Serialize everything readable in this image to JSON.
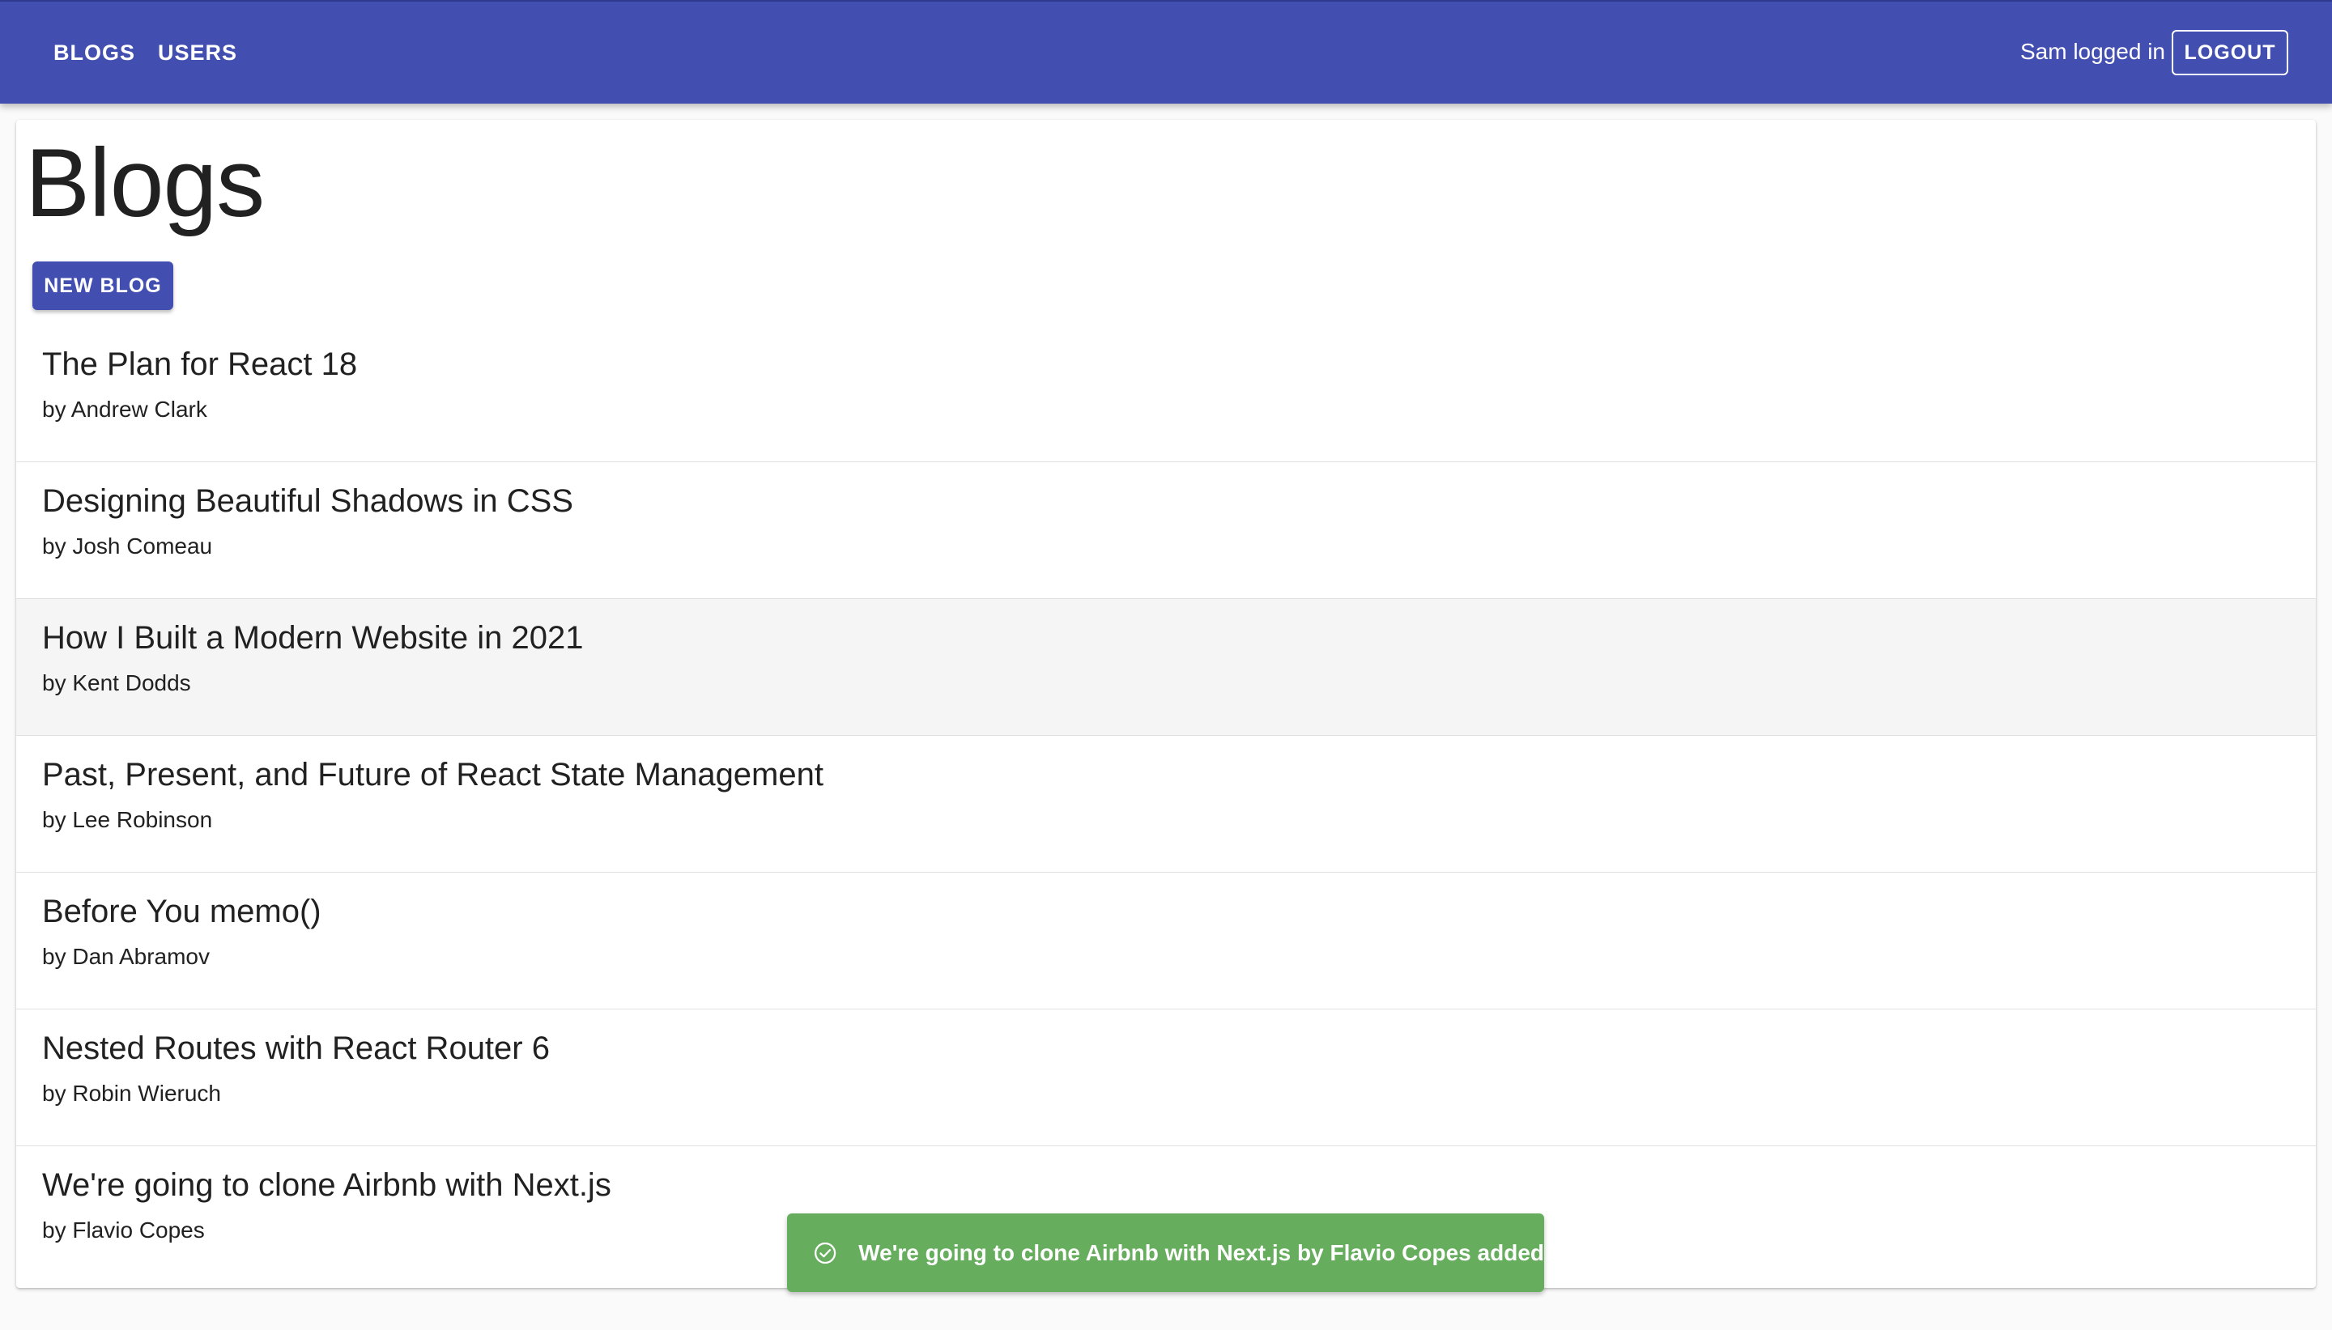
{
  "nav": {
    "blogs_label": "BLOGS",
    "users_label": "USERS",
    "login_status": "Sam logged in",
    "logout_label": "LOGOUT"
  },
  "main": {
    "title": "Blogs",
    "new_blog_label": "NEW BLOG",
    "blogs": [
      {
        "title": "The Plan for React 18",
        "author": "by Andrew Clark"
      },
      {
        "title": "Designing Beautiful Shadows in CSS",
        "author": "by Josh Comeau"
      },
      {
        "title": "How I Built a Modern Website in 2021",
        "author": "by Kent Dodds"
      },
      {
        "title": "Past, Present, and Future of React State Management",
        "author": "by Lee Robinson"
      },
      {
        "title": "Before You memo()",
        "author": "by Dan Abramov"
      },
      {
        "title": "Nested Routes with React Router 6",
        "author": "by Robin Wieruch"
      },
      {
        "title": "We're going to clone Airbnb with Next.js",
        "author": "by Flavio Copes"
      }
    ]
  },
  "notification": {
    "icon": "check-circle-icon",
    "message": "We're going to clone Airbnb with Next.js by Flavio Copes added"
  },
  "colors": {
    "primary": "#434fb0",
    "success": "#66ad5e",
    "hover_row": "#f5f5f5"
  }
}
